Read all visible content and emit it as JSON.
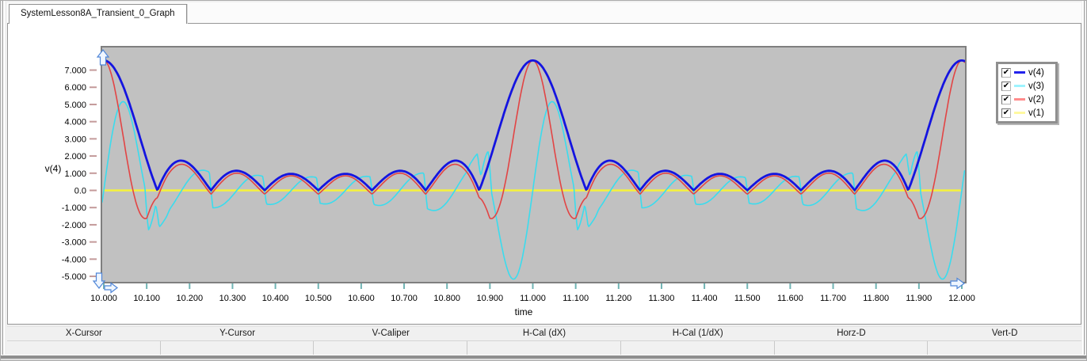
{
  "window": {
    "tab_title": "SystemLesson8A_Transient_0_Graph"
  },
  "legend": {
    "items": [
      {
        "label": "v(4)",
        "checked": true,
        "check_glyph": "✔",
        "swatch": "#2323EC"
      },
      {
        "label": "v(3)",
        "checked": true,
        "check_glyph": "✔",
        "swatch": "#9EF4FF"
      },
      {
        "label": "v(2)",
        "checked": true,
        "check_glyph": "✔",
        "swatch": "#FF8C8C"
      },
      {
        "label": "v(1)",
        "checked": true,
        "check_glyph": "✔",
        "swatch": "#FFF9A0"
      }
    ]
  },
  "toolbar": {
    "items": [
      "X-Cursor",
      "Y-Cursor",
      "V-Caliper",
      "H-Cal (dX)",
      "H-Cal (1/dX)",
      "Horz-D",
      "Vert-D"
    ],
    "cell_values": [
      "",
      "",
      "",
      "",
      "",
      "",
      ""
    ]
  },
  "chart_data": {
    "type": "line",
    "title": "",
    "xlabel": "time",
    "ylabel": "v(4)",
    "x_range": [
      10,
      12
    ],
    "y_view_range": [
      -5.37,
      8.33
    ],
    "grid": false,
    "plot_bg": "#C1C1C1",
    "frame_color": "#7F7F7F",
    "x_tick_color": "#6FB3B3",
    "y_tick_color": "#C49A9A",
    "legend_position": "right-outside",
    "x_tick_values": [
      10.0,
      10.1,
      10.2,
      10.3,
      10.4,
      10.5,
      10.6,
      10.7,
      10.8,
      10.9,
      11.0,
      11.1,
      11.2,
      11.3,
      11.4,
      11.5,
      11.6,
      11.7,
      11.8,
      11.9,
      12.0
    ],
    "x_tick_labels": [
      "10.000",
      "10.100",
      "10.200",
      "10.300",
      "10.400",
      "10.500",
      "10.600",
      "10.700",
      "10.800",
      "10.900",
      "11.000",
      "11.100",
      "11.200",
      "11.300",
      "11.400",
      "11.500",
      "11.600",
      "11.700",
      "11.800",
      "11.900",
      "12.000"
    ],
    "y_tick_values": [
      7,
      6,
      5,
      4,
      3,
      2,
      1,
      0,
      -1,
      -2,
      -3,
      -4,
      -5
    ],
    "y_tick_labels": [
      "7.000",
      "6.000",
      "5.000",
      "4.000",
      "3.000",
      "2.000",
      "1.000",
      "0.0",
      "-1.000",
      "-2.000",
      "-3.000",
      "-4.000",
      "-5.000"
    ],
    "series": [
      {
        "name": "v(1)",
        "color": "#F6F23C",
        "width": 2.4,
        "model": {
          "kind": "constant",
          "value": 0
        }
      },
      {
        "name": "v(3)",
        "color": "#3ADCEE",
        "width": 1.6,
        "model": {
          "kind": "neg_scaled_derivative",
          "of": "v(2)",
          "gain": 0.034,
          "h": 0.004
        },
        "notable": {
          "spike_positive": 5.2,
          "spike_negative": -5.25,
          "spike_offset_from_peak": 0.05
        }
      },
      {
        "name": "v(2)",
        "color": "#E24444",
        "width": 1.6,
        "model": {
          "kind": "dirichlet_sharpened",
          "amplitude": 7.56,
          "harmonics": 8,
          "period": 1,
          "main_halfwidth": 0.068,
          "outer_gain": 0.88,
          "cusp_dip": 0.22,
          "blend": [
            0.1,
            0.15
          ]
        },
        "notable": {
          "main_peak": 7.56,
          "undershoot": -1.3,
          "undershoot_offset": 0.098
        }
      },
      {
        "name": "v(4)",
        "color": "#1414E0",
        "width": 2.8,
        "model": {
          "kind": "abs_dirichlet",
          "amplitude": 7.56,
          "harmonics": 8,
          "period": 1
        },
        "notable": {
          "main_peak": 7.56,
          "zero_spacing": 0.125,
          "sidelobe_peaks": [
            1.7,
            1.14,
            0.97,
            0.97,
            1.14,
            1.7
          ]
        }
      }
    ],
    "notable_values": {
      "main_peak": 7.56,
      "peak_times": [
        10,
        11,
        12
      ],
      "waveform_period": 1.0
    }
  }
}
